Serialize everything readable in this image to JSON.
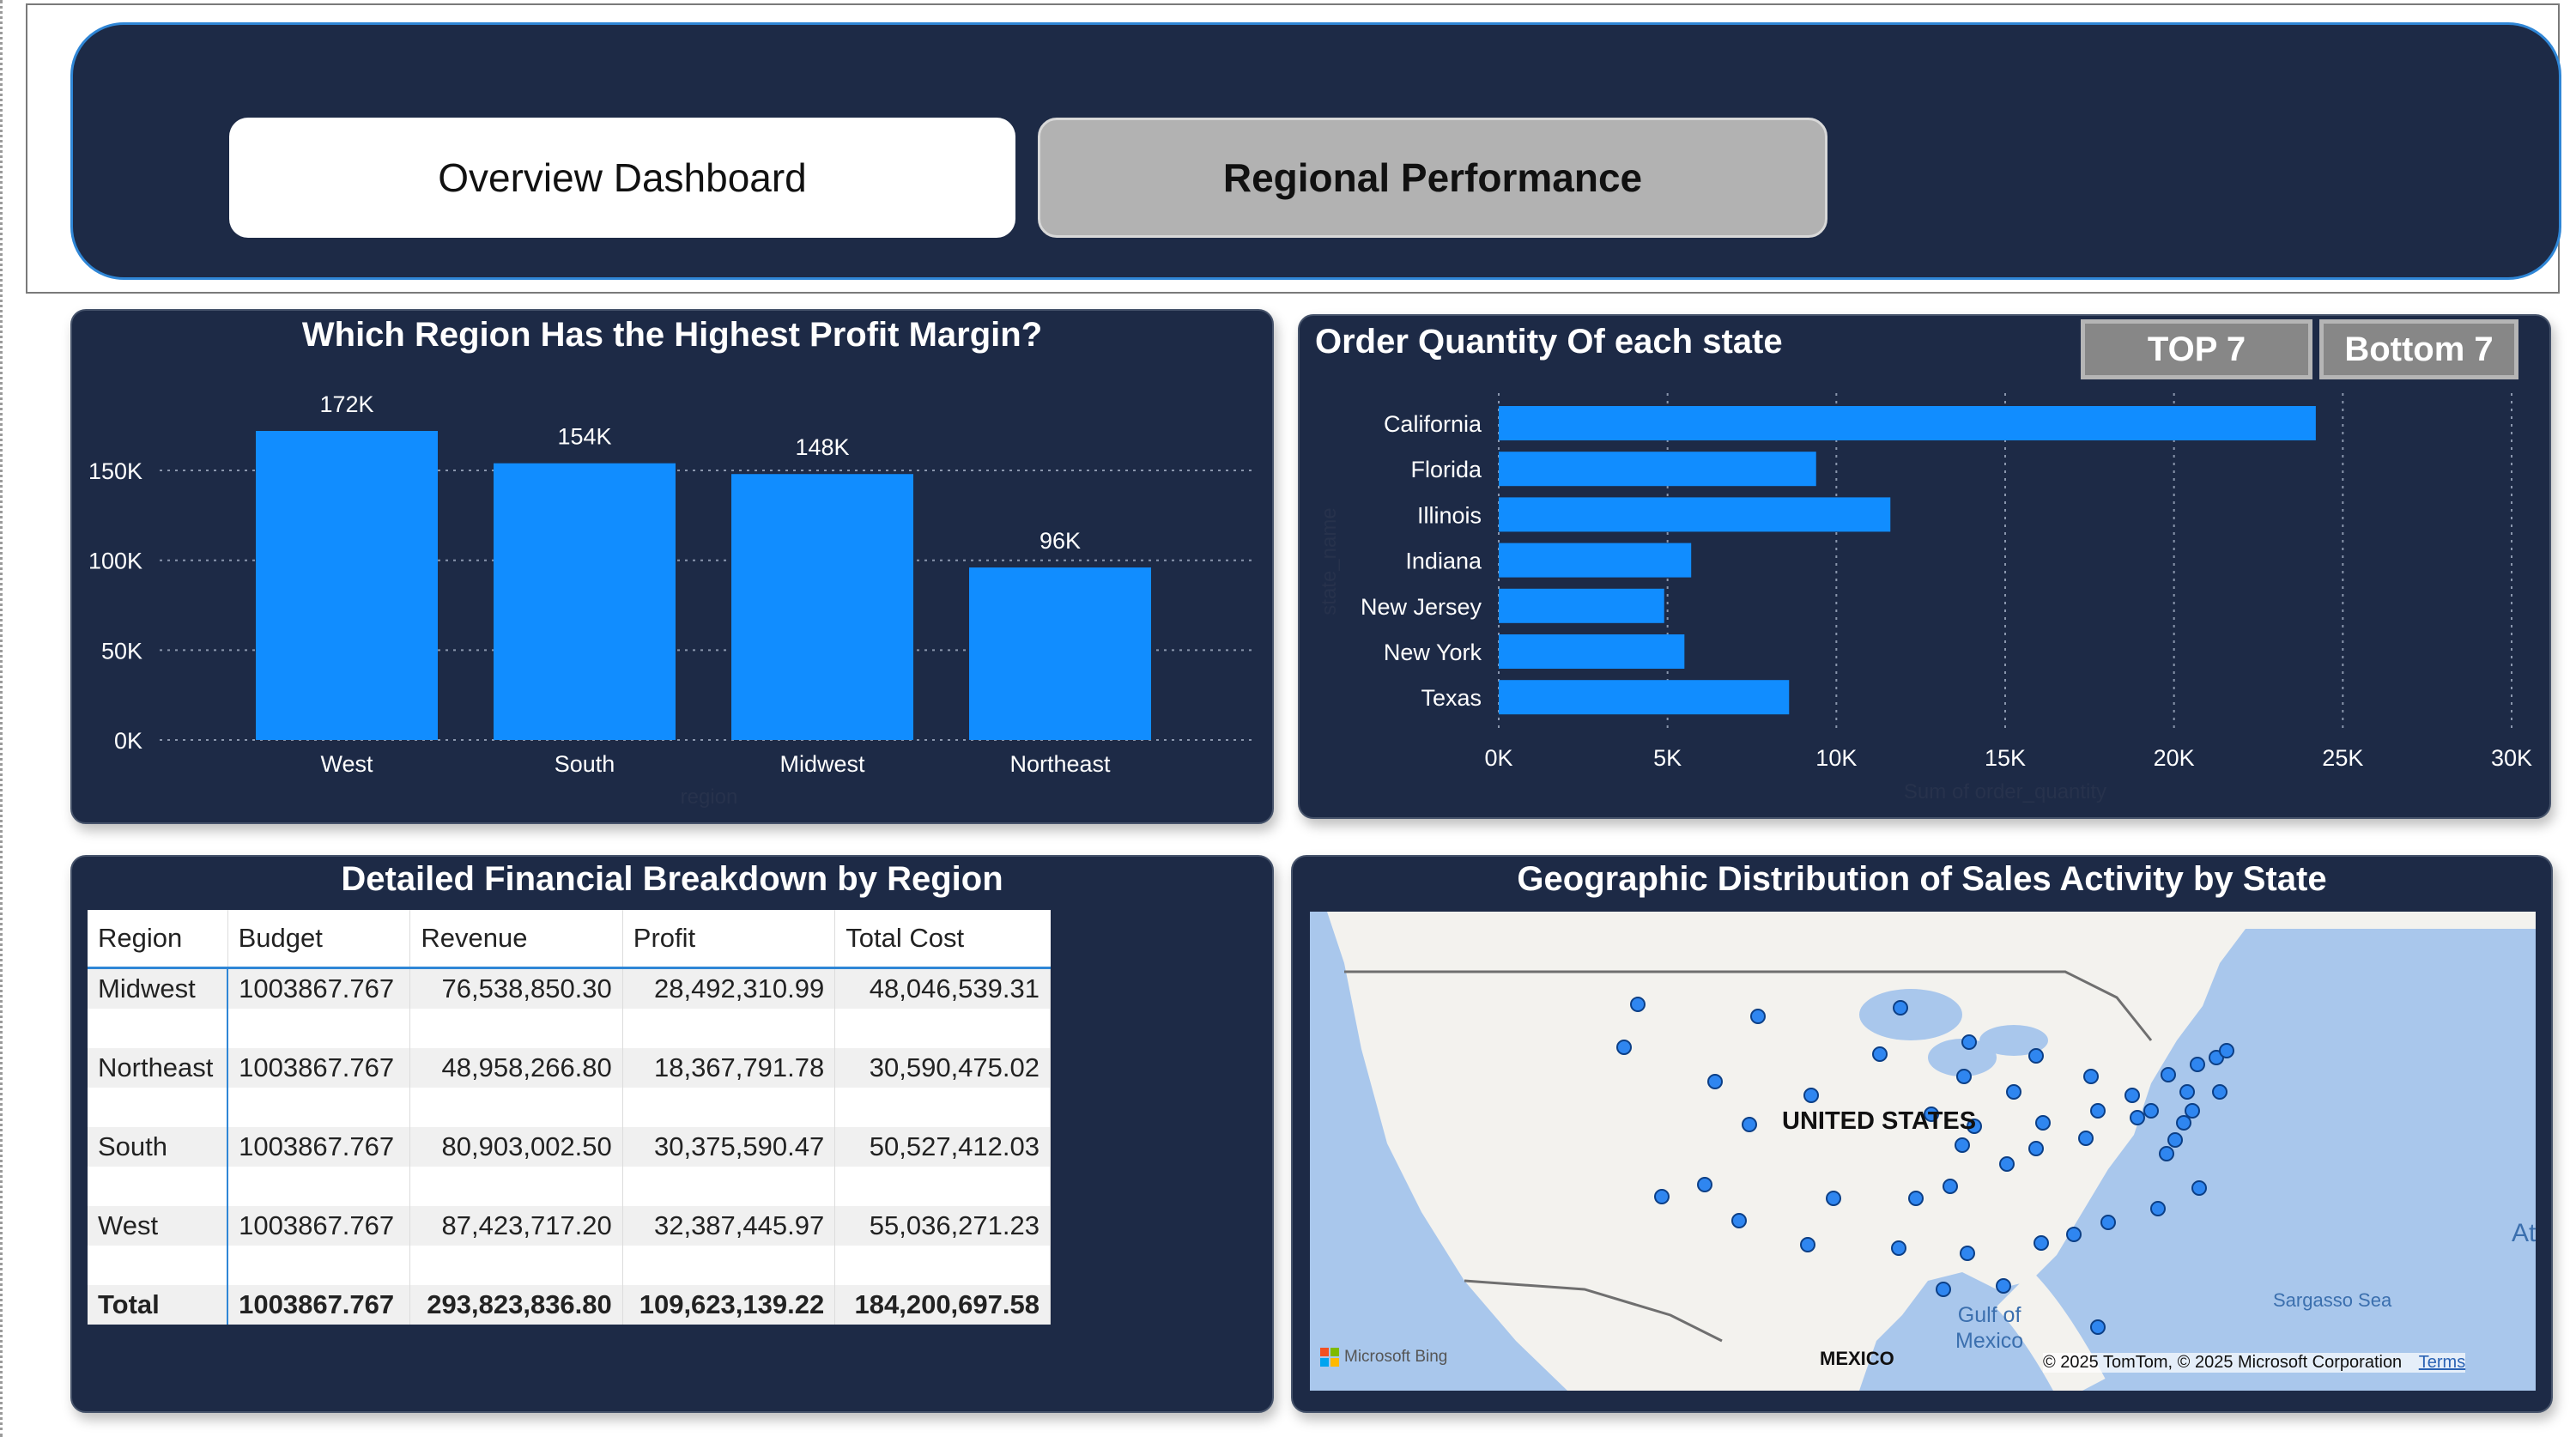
{
  "nav": {
    "overview_label": "Overview Dashboard",
    "regional_label": "Regional Performance"
  },
  "bar_panel": {
    "title": "Which Region Has the Highest Profit Margin?",
    "xlabel": "region"
  },
  "state_panel": {
    "title": "Order Quantity Of each state",
    "top_label": "TOP 7",
    "bottom_label": "Bottom 7",
    "ylabel": "state_name",
    "xlabel": "Sum of order_quantity"
  },
  "table_panel": {
    "title": "Detailed Financial Breakdown by Region",
    "columns": [
      "Region",
      "Budget",
      "Revenue",
      "Profit",
      "Total Cost"
    ],
    "rows": [
      [
        "Midwest",
        "1003867.767",
        "76,538,850.30",
        "28,492,310.99",
        "48,046,539.31"
      ],
      [
        "Northeast",
        "1003867.767",
        "48,958,266.80",
        "18,367,791.78",
        "30,590,475.02"
      ],
      [
        "South",
        "1003867.767",
        "80,903,002.50",
        "30,375,590.47",
        "50,527,412.03"
      ],
      [
        "West",
        "1003867.767",
        "87,423,717.20",
        "32,387,445.97",
        "55,036,271.23"
      ]
    ],
    "total": [
      "Total",
      "1003867.767",
      "293,823,836.80",
      "109,623,139.22",
      "184,200,697.58"
    ]
  },
  "map_panel": {
    "title": "Geographic Distribution of Sales Activity by State",
    "country_label": "UNITED STATES",
    "gulf_label_1": "Gulf of",
    "gulf_label_2": "Mexico",
    "sea_label": "Sargasso Sea",
    "mexico_label": "MEXICO",
    "bing_label": "Microsoft Bing",
    "copyright": "© 2025 TomTom, © 2025 Microsoft Corporation",
    "terms": "Terms",
    "edge_label": "At"
  },
  "chart_data": [
    {
      "type": "bar",
      "title": "Which Region Has the Highest Profit Margin?",
      "categories": [
        "West",
        "South",
        "Midwest",
        "Northeast"
      ],
      "values": [
        172000,
        154000,
        148000,
        96000
      ],
      "data_labels": [
        "172K",
        "154K",
        "148K",
        "96K"
      ],
      "xlabel": "region",
      "ylabel": "",
      "ylim": [
        0,
        172000
      ],
      "yticks": [
        0,
        50000,
        100000,
        150000
      ],
      "ytick_labels": [
        "0K",
        "50K",
        "100K",
        "150K"
      ],
      "grid": true,
      "color": "#118dff"
    },
    {
      "type": "bar",
      "orientation": "horizontal",
      "title": "Order Quantity Of each state",
      "categories": [
        "California",
        "Florida",
        "Illinois",
        "Indiana",
        "New Jersey",
        "New York",
        "Texas"
      ],
      "values": [
        24200,
        9400,
        11600,
        5700,
        4900,
        5500,
        8600
      ],
      "xlabel": "Sum of order_quantity",
      "ylabel": "state_name",
      "xlim": [
        0,
        30000
      ],
      "xticks": [
        0,
        5000,
        10000,
        15000,
        20000,
        25000,
        30000
      ],
      "xtick_labels": [
        "0K",
        "5K",
        "10K",
        "15K",
        "20K",
        "25K",
        "30K"
      ],
      "grid": true,
      "color": "#118dff"
    }
  ]
}
